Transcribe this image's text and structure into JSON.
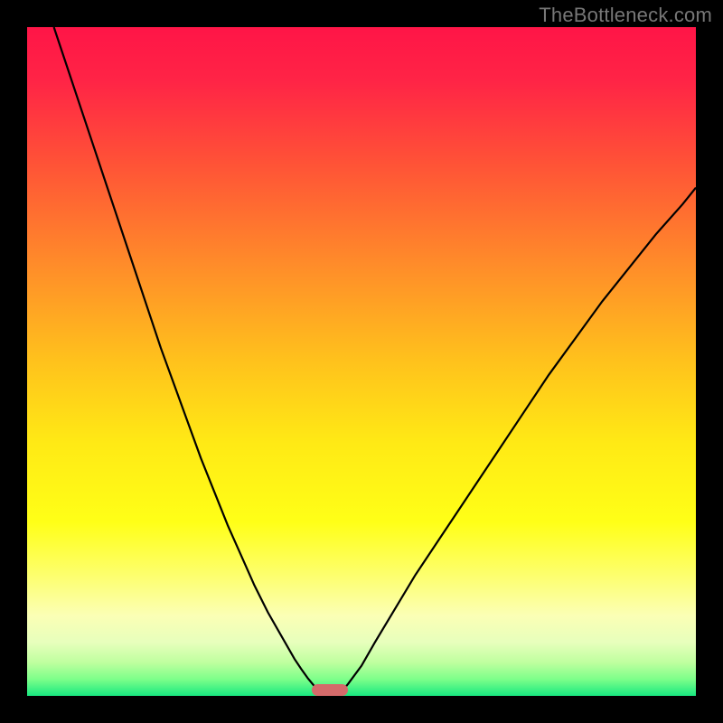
{
  "watermark": "TheBottleneck.com",
  "chart_data": {
    "type": "line",
    "title": "",
    "xlabel": "",
    "ylabel": "",
    "xlim": [
      0,
      100
    ],
    "ylim": [
      0,
      100
    ],
    "grid": false,
    "legend": false,
    "background_gradient": [
      {
        "stop": 0.0,
        "color": "#ff1547"
      },
      {
        "stop": 0.08,
        "color": "#ff2446"
      },
      {
        "stop": 0.2,
        "color": "#ff5137"
      },
      {
        "stop": 0.35,
        "color": "#ff8a2a"
      },
      {
        "stop": 0.5,
        "color": "#ffc21c"
      },
      {
        "stop": 0.62,
        "color": "#ffe915"
      },
      {
        "stop": 0.74,
        "color": "#ffff17"
      },
      {
        "stop": 0.82,
        "color": "#fdff6e"
      },
      {
        "stop": 0.88,
        "color": "#fbffb5"
      },
      {
        "stop": 0.92,
        "color": "#e7ffbc"
      },
      {
        "stop": 0.95,
        "color": "#bfff9f"
      },
      {
        "stop": 0.975,
        "color": "#7dff8a"
      },
      {
        "stop": 1.0,
        "color": "#18e880"
      }
    ],
    "series": [
      {
        "name": "left-branch",
        "color": "#000000",
        "x": [
          4,
          6,
          8,
          10,
          12,
          14,
          16,
          18,
          20,
          22,
          24,
          26,
          28,
          30,
          32,
          34,
          36,
          38,
          40,
          41,
          42,
          43,
          43.5
        ],
        "y": [
          100,
          94,
          88,
          82,
          76,
          70,
          64,
          58,
          52,
          46.5,
          41,
          35.5,
          30.5,
          25.5,
          21,
          16.5,
          12.5,
          9,
          5.5,
          4,
          2.6,
          1.4,
          0.6
        ]
      },
      {
        "name": "right-branch",
        "color": "#000000",
        "x": [
          47,
          48,
          50,
          52,
          55,
          58,
          62,
          66,
          70,
          74,
          78,
          82,
          86,
          90,
          94,
          98,
          100
        ],
        "y": [
          0.6,
          1.8,
          4.5,
          8,
          13,
          18,
          24,
          30,
          36,
          42,
          48,
          53.5,
          59,
          64,
          69,
          73.5,
          76
        ]
      }
    ],
    "marker": {
      "name": "bottleneck-marker",
      "x_start": 42.5,
      "x_end": 48,
      "y": 0,
      "height_pct": 1.7,
      "color": "#d46a6a"
    }
  }
}
